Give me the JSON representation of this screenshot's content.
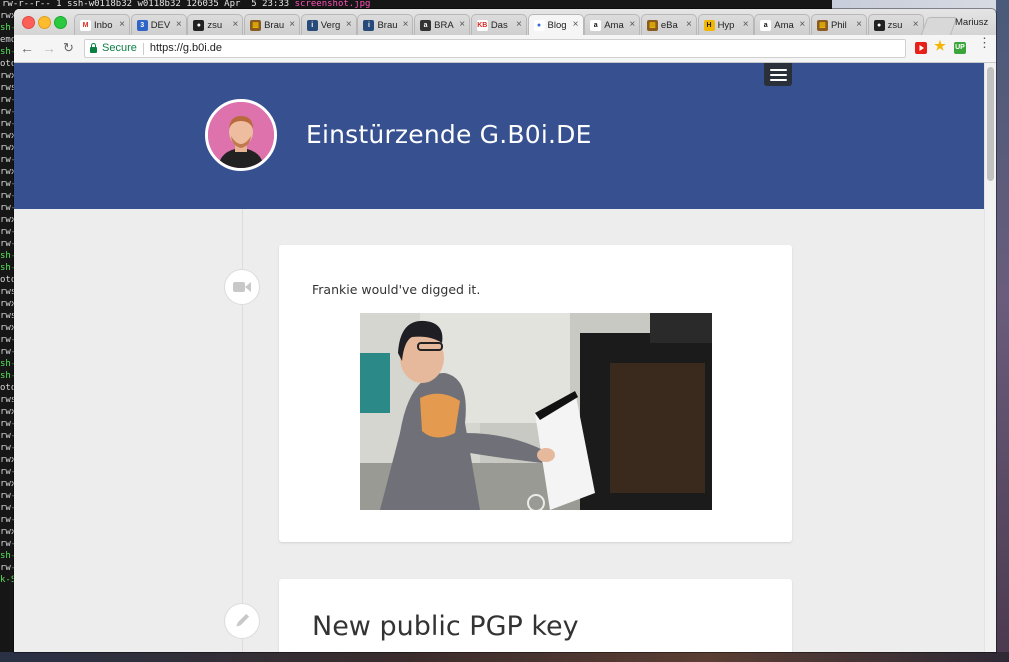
{
  "terminal": {
    "top_line": "rw-r--r-- 1 ssh-w0118b32 w0118b32 126035 Apr  5 23:33 ",
    "top_file": "screenshot.jpg",
    "lines": [
      {
        "t": "rwx",
        "g": false
      },
      {
        "t": "sh-",
        "g": true
      },
      {
        "t": "emo",
        "g": false
      },
      {
        "t": "sh-",
        "g": true
      },
      {
        "t": "oto",
        "g": false
      },
      {
        "t": "rwx",
        "g": false
      },
      {
        "t": "rws",
        "g": false
      },
      {
        "t": "rw-",
        "g": false
      },
      {
        "t": "rw-",
        "g": false
      },
      {
        "t": "rw-",
        "g": false
      },
      {
        "t": "rwx",
        "g": false
      },
      {
        "t": "rwx",
        "g": false
      },
      {
        "t": "rw-",
        "g": false
      },
      {
        "t": "rwx",
        "g": false
      },
      {
        "t": "rw-",
        "g": false
      },
      {
        "t": "rw-",
        "g": false
      },
      {
        "t": "rw-",
        "g": false
      },
      {
        "t": "rwx",
        "g": false
      },
      {
        "t": "rw-",
        "g": false
      },
      {
        "t": "rw-",
        "g": false
      },
      {
        "t": "sh-",
        "g": true
      },
      {
        "t": "sh-",
        "g": true
      },
      {
        "t": "oto",
        "g": false
      },
      {
        "t": "rws",
        "g": false
      },
      {
        "t": "rwx",
        "g": false
      },
      {
        "t": "rws",
        "g": false
      },
      {
        "t": "rwx",
        "g": false
      },
      {
        "t": "rw-",
        "g": false
      },
      {
        "t": "rw-",
        "g": false
      },
      {
        "t": "sh-",
        "g": true
      },
      {
        "t": "sh-",
        "g": true
      },
      {
        "t": "oto",
        "g": false
      },
      {
        "t": "rws",
        "g": false
      },
      {
        "t": "rwx",
        "g": false
      },
      {
        "t": "rw-",
        "g": false
      },
      {
        "t": "rw-",
        "g": false
      },
      {
        "t": "rw-",
        "g": false
      },
      {
        "t": "rwx",
        "g": false
      },
      {
        "t": "rw-",
        "g": false
      },
      {
        "t": "rwx",
        "g": false
      },
      {
        "t": "rw-",
        "g": false
      },
      {
        "t": "rw-",
        "g": false
      },
      {
        "t": "rw-",
        "g": false
      },
      {
        "t": "rwx",
        "g": false
      },
      {
        "t": "rw-",
        "g": false
      },
      {
        "t": "sh-",
        "g": true
      },
      {
        "t": "rw-",
        "g": false
      },
      {
        "t": "k-S",
        "g": true
      }
    ]
  },
  "browser": {
    "tabs": [
      {
        "label": "Inbo",
        "icon": "gmail-icon",
        "fav": "M",
        "color": "#ffffff",
        "fg": "#d93025",
        "active": false
      },
      {
        "label": "DEV",
        "icon": "dev-icon",
        "fav": "3",
        "color": "#2f64c8",
        "fg": "#ffffff",
        "active": false
      },
      {
        "label": "zsu",
        "icon": "github-icon",
        "fav": "●",
        "color": "#222222",
        "fg": "#ffffff",
        "active": false
      },
      {
        "label": "Brau",
        "icon": "brau-icon",
        "fav": "▥",
        "color": "#8a5a20",
        "fg": "#f2c000",
        "active": false
      },
      {
        "label": "Verg",
        "icon": "info-icon",
        "fav": "i",
        "color": "#264a7a",
        "fg": "#ffffff",
        "active": false
      },
      {
        "label": "Brau",
        "icon": "info-icon",
        "fav": "i",
        "color": "#264a7a",
        "fg": "#ffffff",
        "active": false
      },
      {
        "label": "BRA",
        "icon": "adv-icon",
        "fav": "a",
        "color": "#333333",
        "fg": "#ffffff",
        "active": false
      },
      {
        "label": "Das",
        "icon": "kb-icon",
        "fav": "KB",
        "color": "#ffffff",
        "fg": "#d6261f",
        "active": false
      },
      {
        "label": "Blog",
        "icon": "blog-icon",
        "fav": "●",
        "color": "#ffffff",
        "fg": "#2b6fd6",
        "active": true
      },
      {
        "label": "Ama",
        "icon": "amazon-icon",
        "fav": "a",
        "color": "#ffffff",
        "fg": "#111111",
        "active": false
      },
      {
        "label": "eBa",
        "icon": "ebay-icon",
        "fav": "▥",
        "color": "#8a5a20",
        "fg": "#f2c000",
        "active": false
      },
      {
        "label": "Hyp",
        "icon": "hyp-icon",
        "fav": "H",
        "color": "#f2b705",
        "fg": "#222222",
        "active": false
      },
      {
        "label": "Ama",
        "icon": "amazon-icon",
        "fav": "a",
        "color": "#ffffff",
        "fg": "#111111",
        "active": false
      },
      {
        "label": "Phil",
        "icon": "phil-icon",
        "fav": "▥",
        "color": "#8a5a20",
        "fg": "#f2c000",
        "active": false
      },
      {
        "label": "zsu",
        "icon": "github-icon",
        "fav": "●",
        "color": "#222222",
        "fg": "#ffffff",
        "active": false
      }
    ],
    "tab_close": "×",
    "profile_name": "Mariusz",
    "nav": {
      "back": "←",
      "forward": "→",
      "reload": "↻"
    },
    "secure_label": "Secure",
    "url": "https://g.b0i.de",
    "ext_up": "UP",
    "ext_star": "★",
    "menu": "⋮"
  },
  "site": {
    "title": "Einstürzende G.B0i.DE",
    "posts": [
      {
        "icon": "video-camera-icon",
        "text": "Frankie would've digged it."
      },
      {
        "icon": "pencil-icon",
        "title": "New public PGP key"
      }
    ]
  }
}
